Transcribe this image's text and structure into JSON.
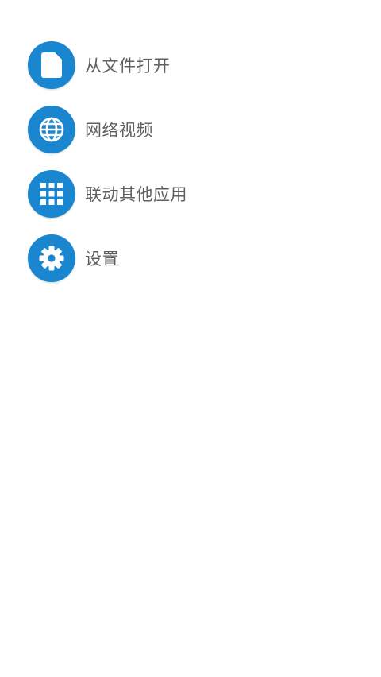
{
  "colors": {
    "accent": "#1a86d0",
    "icon_fg": "#ffffff",
    "label_text": "#5f5f5f",
    "background": "#ffffff"
  },
  "menu": {
    "items": [
      {
        "label": "从文件打开",
        "icon": "file-icon"
      },
      {
        "label": "网络视频",
        "icon": "globe-icon"
      },
      {
        "label": "联动其他应用",
        "icon": "apps-grid-icon"
      },
      {
        "label": "设置",
        "icon": "gear-icon"
      }
    ]
  }
}
